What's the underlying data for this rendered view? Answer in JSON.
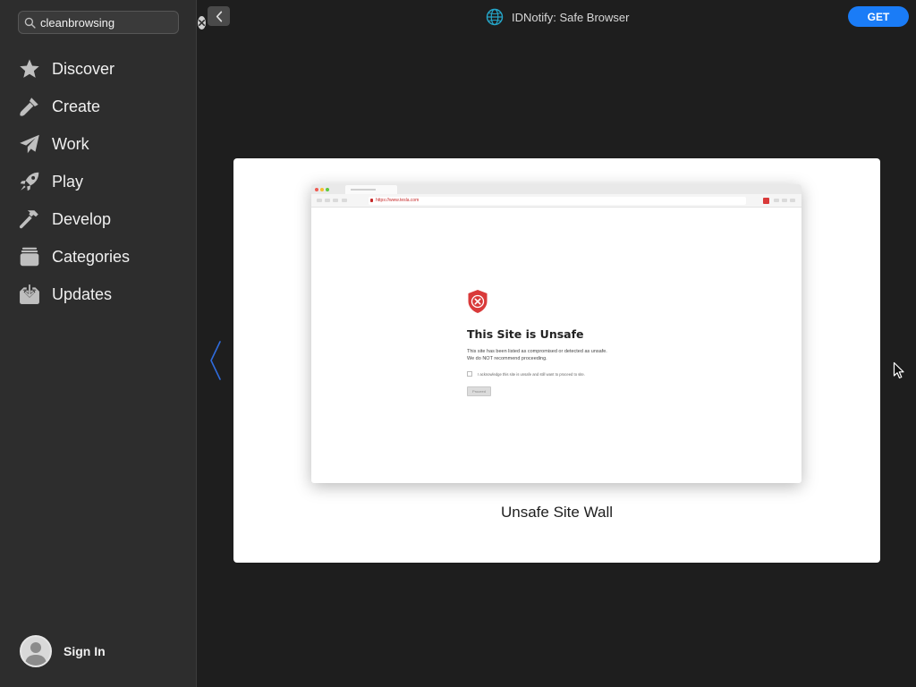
{
  "search": {
    "value": "cleanbrowsing",
    "placeholder": "Search"
  },
  "sidebar": {
    "items": [
      {
        "label": "Discover",
        "icon": "star-icon"
      },
      {
        "label": "Create",
        "icon": "brush-icon"
      },
      {
        "label": "Work",
        "icon": "paper-plane-icon"
      },
      {
        "label": "Play",
        "icon": "rocket-icon"
      },
      {
        "label": "Develop",
        "icon": "hammer-icon"
      },
      {
        "label": "Categories",
        "icon": "stack-icon"
      },
      {
        "label": "Updates",
        "icon": "download-icon"
      }
    ],
    "signin_label": "Sign In"
  },
  "header": {
    "title": "IDNotify: Safe Browser",
    "get_label": "GET"
  },
  "screenshot": {
    "caption": "Unsafe Site Wall",
    "browser": {
      "url": "https://www.tesla.com",
      "heading": "This Site is Unsafe",
      "message_line1": "This site has been listed as compromised or detected as unsafe.",
      "message_line2": "We do NOT recommend proceeding.",
      "acknowledge": "I acknowledge this site is unsafe and still want to proceed to site.",
      "proceed_label": "Proceed"
    }
  },
  "colors": {
    "accent": "#1a7cf7",
    "sidebar_bg": "#2d2d2d",
    "content_bg": "#1e1e1e",
    "danger": "#d93a3a"
  }
}
